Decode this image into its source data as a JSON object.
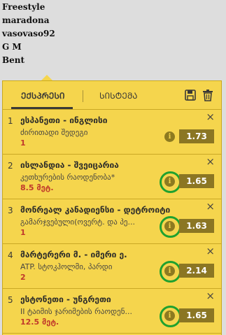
{
  "list": [
    "Freestyle",
    "maradona",
    "vasovaso92",
    "G M",
    "Bent"
  ],
  "tabs": {
    "express": "ᲔᲥᲡᲞᲠᲔᲡᲘ",
    "system": "ᲡᲘᲡᲢᲔᲛᲐ"
  },
  "bets": [
    {
      "num": "1",
      "match": "ესპანეთი - ინგლისი",
      "market": "ძირითადი შედეგი",
      "selection": "1",
      "odds": "1.73"
    },
    {
      "num": "2",
      "match": "ისლანდია - შვეიცარია",
      "market": "კეთხურების რაოდენობა*",
      "selection": "8.5 მეტ.",
      "odds": "1.65"
    },
    {
      "num": "3",
      "match": "მონრეალ კანადიენსი - დეტროიტი",
      "market": "გამარჯვებული(ოვერტ. და პე...",
      "selection": "1",
      "odds": "1.63"
    },
    {
      "num": "4",
      "match": "მარტერერი მ. - იმერი ე.",
      "market": "ATP. სტოკჰოლმი, პარდი",
      "selection": "2",
      "odds": "2.14"
    },
    {
      "num": "5",
      "match": "ესტონეთი - უნგრეთი",
      "market": "II ტაიმის ჯარიმების რაოდენ...",
      "selection": "12.5 მეტ.",
      "odds": "1.65"
    }
  ],
  "icons": {
    "info": "i",
    "close": "×"
  },
  "colors": {
    "panel": "#f5d54d",
    "odds_bg": "#8b7623",
    "highlight": "#1fa12f",
    "selection": "#c0392b"
  }
}
